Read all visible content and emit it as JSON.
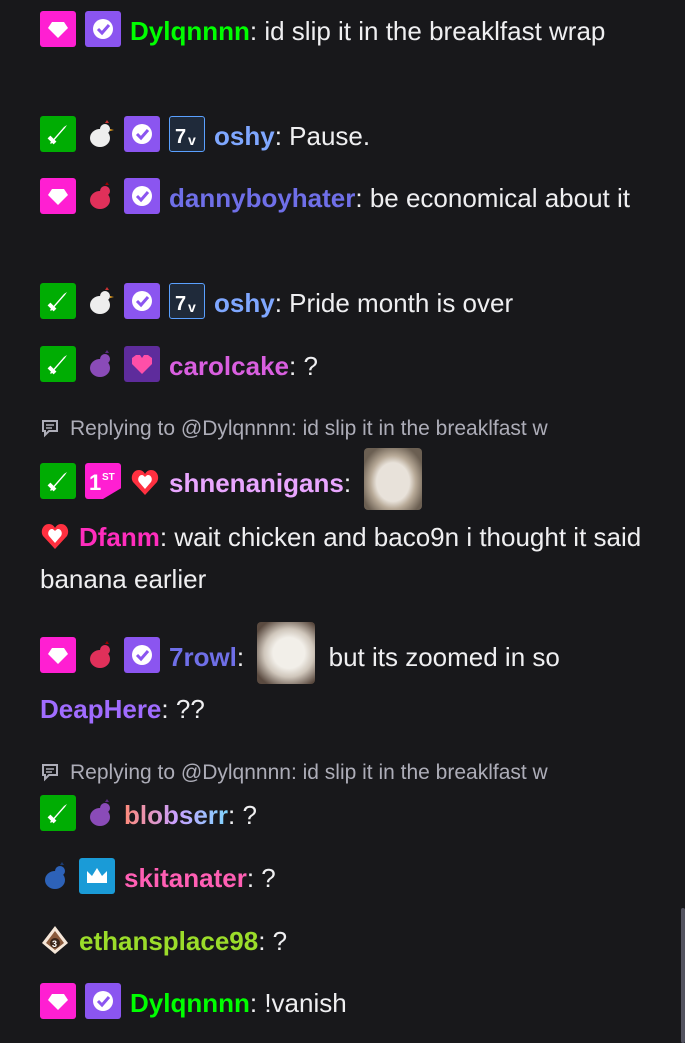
{
  "messages": [
    {
      "user": "Dylqnnnn",
      "text": "id slip it in the breaklfast wrap",
      "color": "#00ff00",
      "badges": [
        "sub-heart-badge",
        "verified-badge"
      ]
    },
    {
      "user": "oshy",
      "text": "Pause.",
      "color": "#7fa7ff",
      "badges": [
        "mod-sword-badge",
        "chicken-badge",
        "verified-badge",
        "seven-tv-badge"
      ]
    },
    {
      "user": "dannyboyhater",
      "text": "be economical about it",
      "color": "#6f6fe8",
      "badges": [
        "sub-heart-badge",
        "chicken-badge",
        "verified-badge"
      ]
    },
    {
      "user": "oshy",
      "text": "Pride month is over",
      "color": "#7fa7ff",
      "badges": [
        "mod-sword-badge",
        "chicken-badge",
        "verified-badge",
        "seven-tv-badge"
      ]
    },
    {
      "user": "carolcake",
      "text": "?",
      "color": "#d95fe0",
      "badges": [
        "mod-sword-badge",
        "chicken-badge",
        "pixel-heart-badge"
      ]
    },
    {
      "reply": "Replying to @Dylqnnnn: id slip it in the breaklfast w"
    },
    {
      "user": "shnenanigans",
      "text": "",
      "color": "#e9a6ff",
      "badges": [
        "mod-sword-badge",
        "first-badge",
        "heart-badge"
      ],
      "emote": "cat-emote"
    },
    {
      "user": "Dfanm",
      "text": "wait chicken and baco9n i thought it said banana earlier",
      "color": "#ff2dbd",
      "badges": [
        "heart-badge"
      ]
    },
    {
      "user": "7rowl",
      "text": "but its zoomed in so",
      "color": "#6f6fe8",
      "badges": [
        "sub-heart-badge",
        "chicken-badge",
        "verified-badge"
      ],
      "emote": "dog-emote"
    },
    {
      "user": "DeapHere",
      "text": "??",
      "color": "#a06cff",
      "badges": []
    },
    {
      "reply": "Replying to @Dylqnnnn: id slip it in the breaklfast w"
    },
    {
      "user": "blobserr",
      "text": "?",
      "color": "#ff9a7a",
      "badges": [
        "mod-sword-badge",
        "chicken-badge"
      ]
    },
    {
      "user": "skitanater",
      "text": "?",
      "color": "#ff5fb4",
      "badges": [
        "chicken-badge",
        "crown-badge"
      ]
    },
    {
      "user": "ethansplace98",
      "text": "?",
      "color": "#9bdc2a",
      "badges": [
        "gift-badge"
      ]
    },
    {
      "user": "Dylqnnnn",
      "text": "!vanish",
      "color": "#00ff00",
      "badges": [
        "sub-heart-badge",
        "verified-badge"
      ]
    }
  ]
}
